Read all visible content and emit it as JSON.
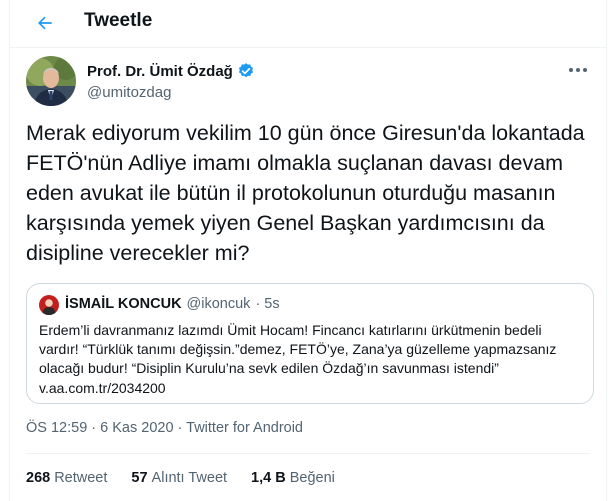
{
  "header": {
    "title": "Tweetle",
    "back_icon": "arrow-left-icon"
  },
  "colors": {
    "accent": "#1d9bf0",
    "verified": "#1d9bf0",
    "muted": "#536471",
    "text": "#0f1419",
    "border": "#cfd9de"
  },
  "tweet": {
    "author_name": "Prof. Dr. Ümit Özdağ",
    "verified_icon": "verified-badge-icon",
    "author_handle": "@umitozdag",
    "more_icon": "more-options-icon",
    "text": "Merak ediyorum vekilim 10 gün önce Giresun'da lokantada FETÖ'nün Adliye imamı olmakla suçlanan davası devam eden avukat ile bütün il protokolunun oturduğu masanın karşısında yemek yiyen Genel Başkan yardımcısını da disipline verecekler mi?",
    "timestamp": "ÖS 12:59 · 6 Kas 2020",
    "separator": " · ",
    "source": "Twitter for Android"
  },
  "quote": {
    "author_name": "İSMAİL KONCUK",
    "author_handle": "@ikoncuk",
    "time": "· 5s",
    "text_lines": [
      "Erdem’li davranmanız lazımdı Ümit Hocam! Fincancı katırlarını ürkütmenin bedeli",
      "vardır! “Türklük tanımı değişsin.”demez, FETÖ’ye, Zana’ya güzelleme yapmazsanız",
      "olacağı budur! “Disiplin Kurulu’na sevk edilen Özdağ’ın savunması istendi”",
      "v.aa.com.tr/2034200"
    ]
  },
  "stats": {
    "retweets": {
      "count": "268",
      "label": "Retweet"
    },
    "quotes": {
      "count": "57",
      "label": "Alıntı Tweet"
    },
    "likes": {
      "count": "1,4 B",
      "label": "Beğeni"
    }
  }
}
